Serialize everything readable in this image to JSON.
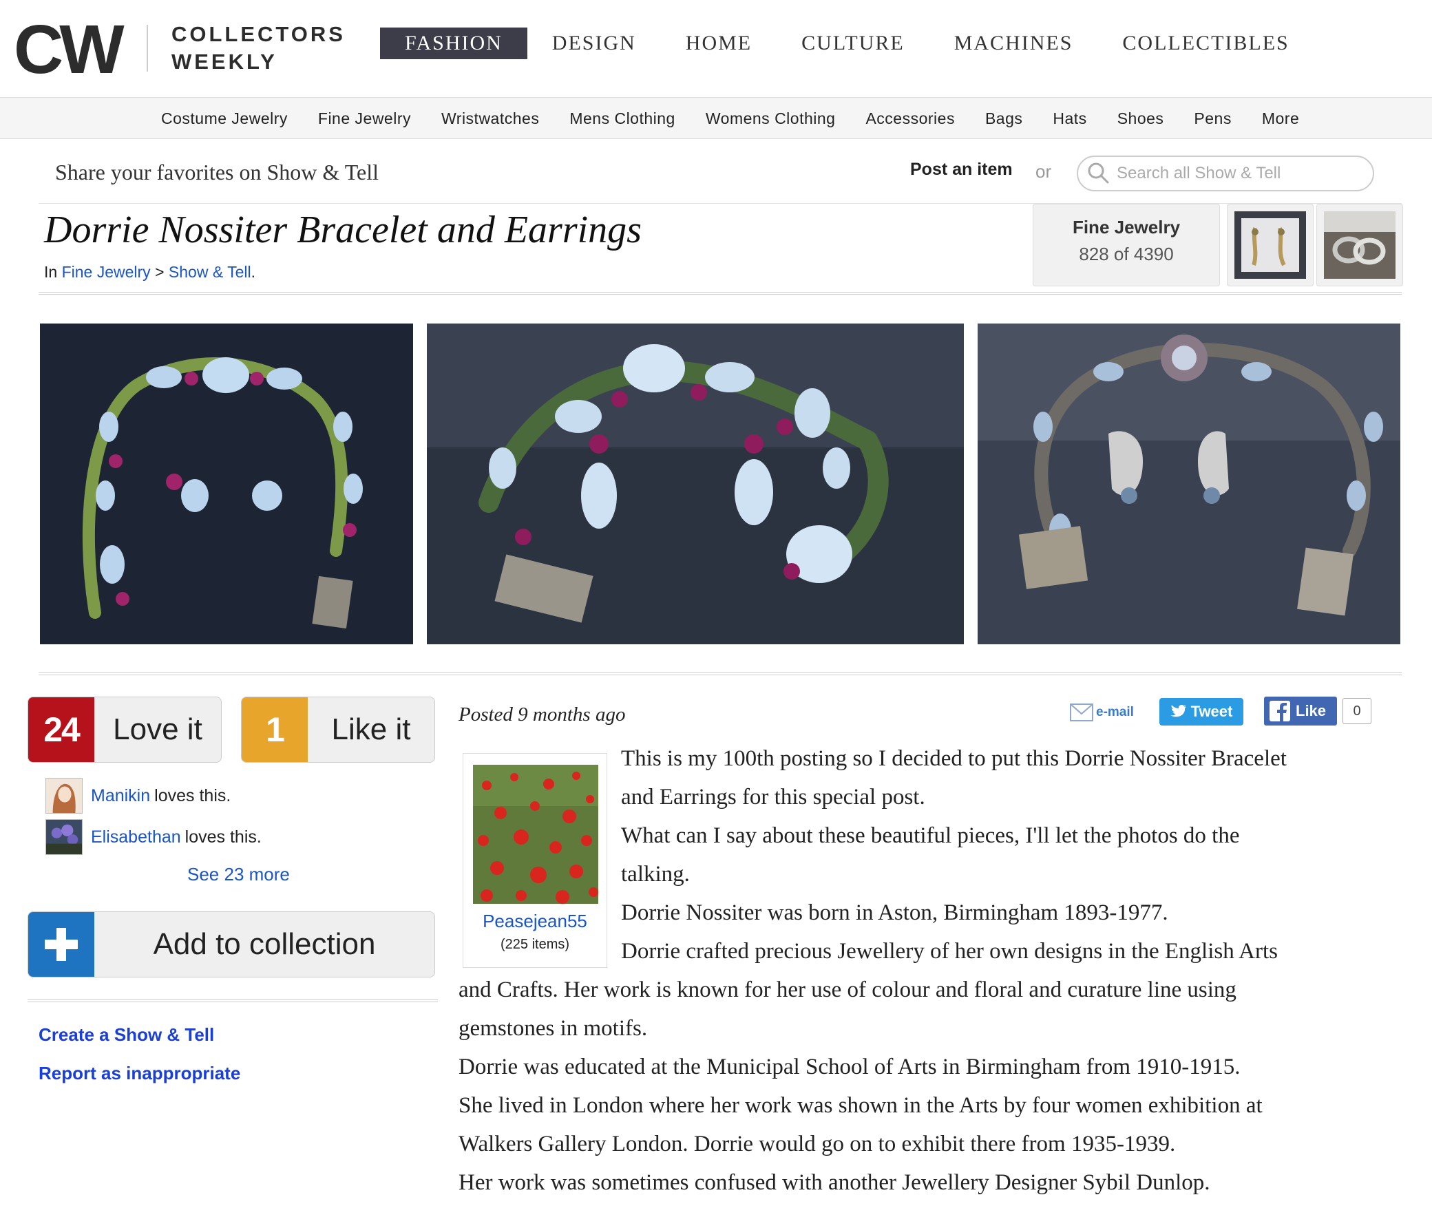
{
  "header": {
    "logo_mark": "CW",
    "logo_line1": "COLLECTORS",
    "logo_line2": "WEEKLY",
    "nav": [
      "FASHION",
      "DESIGN",
      "HOME",
      "CULTURE",
      "MACHINES",
      "COLLECTIBLES"
    ],
    "active_nav": "FASHION"
  },
  "subnav": [
    "Costume Jewelry",
    "Fine Jewelry",
    "Wristwatches",
    "Mens Clothing",
    "Womens Clothing",
    "Accessories",
    "Bags",
    "Hats",
    "Shoes",
    "Pens",
    "More"
  ],
  "share_bar": {
    "title": "Share your favorites on Show & Tell",
    "post_item": "Post an item",
    "or": "or",
    "search_placeholder": "Search all Show & Tell"
  },
  "item": {
    "title": "Dorrie Nossiter Bracelet and Earrings",
    "breadcrumb_in": "In",
    "breadcrumb_cat": "Fine Jewelry",
    "breadcrumb_sep": ">",
    "breadcrumb_show": "Show & Tell",
    "breadcrumb_end": "."
  },
  "category_box": {
    "name": "Fine Jewelry",
    "position": "828 of 4390"
  },
  "reactions": {
    "love_count": "24",
    "love_label": "Love it",
    "like_count": "1",
    "like_label": "Like it",
    "lovers": [
      {
        "name": "Manikin",
        "suffix": "loves this."
      },
      {
        "name": "Elisabethan",
        "suffix": "loves this."
      }
    ],
    "see_more": "See 23 more"
  },
  "add_collection": "Add to collection",
  "side_links": [
    "Create a Show & Tell",
    "Report as inappropriate"
  ],
  "post": {
    "posted": "Posted 9 months ago",
    "email": "e-mail",
    "tweet": "Tweet",
    "fb_like": "Like",
    "fb_count": "0",
    "user_name": "Peasejean55",
    "user_items": "(225 items)",
    "lines": [
      "This is my 100th posting so I decided to put this Dorrie Nossiter Bracelet",
      "and Earrings for this special post.",
      "What can I say about these beautiful pieces, I'll let the photos do the",
      "talking.",
      "Dorrie Nossiter was born in Aston, Birmingham 1893-1977.",
      "Dorrie crafted precious Jewellery of her own designs in the English Arts",
      "and Crafts. Her work is known for her use of colour and floral and curature line using",
      "gemstones in motifs.",
      "Dorrie was educated at the Municipal School of Arts in Birmingham from 1910-1915.",
      "She lived in London where her work was shown in the Arts by four women exhibition at",
      "Walkers Gallery London. Dorrie would go on to exhibit there from 1935-1939.",
      "Her work was sometimes confused with another Jewellery Designer Sybil Dunlop."
    ]
  },
  "colors": {
    "love": "#b5121b",
    "like": "#e8a52b",
    "add": "#1f74c2",
    "link": "#1a55c7",
    "nav_active": "#3d3d49"
  }
}
